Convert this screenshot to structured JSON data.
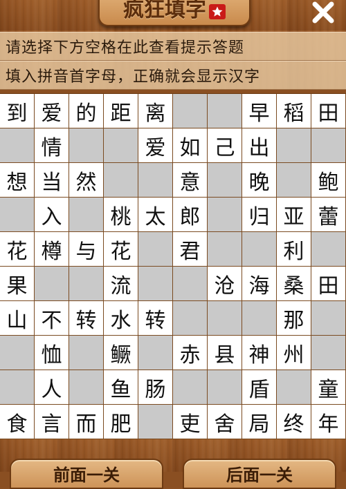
{
  "title": "疯狂填字",
  "hints": {
    "line1": "请选择下方空格在此查看提示答题",
    "line2": "填入拼音首字母，正确就会显示汉字"
  },
  "grid": [
    [
      "到",
      "爱",
      "的",
      "距",
      "离",
      "",
      "",
      "早",
      "稻",
      "田"
    ],
    [
      "",
      "情",
      "",
      "",
      "爱",
      "如",
      "己",
      "出",
      "",
      ""
    ],
    [
      "想",
      "当",
      "然",
      "",
      "",
      "意",
      "",
      "晚",
      "",
      "鲍"
    ],
    [
      "",
      "入",
      "",
      "桃",
      "太",
      "郎",
      "",
      "归",
      "亚",
      "蕾"
    ],
    [
      "花",
      "樽",
      "与",
      "花",
      "",
      "君",
      "",
      "",
      "利",
      ""
    ],
    [
      "果",
      "",
      "",
      "流",
      "",
      "",
      "沧",
      "海",
      "桑",
      "田"
    ],
    [
      "山",
      "不",
      "转",
      "水",
      "转",
      "",
      "",
      "",
      "那",
      ""
    ],
    [
      "",
      "恤",
      "",
      "鳜",
      "",
      "赤",
      "县",
      "神",
      "州",
      ""
    ],
    [
      "",
      "人",
      "",
      "鱼",
      "肠",
      "",
      "",
      "盾",
      "",
      "童"
    ],
    [
      "食",
      "言",
      "而",
      "肥",
      "",
      "吏",
      "舍",
      "局",
      "终",
      "年"
    ]
  ],
  "nav": {
    "prev_label": "前面一关",
    "next_label": "后面一关"
  },
  "icons": {
    "close": "close-icon",
    "title_badge": "star-icon"
  },
  "colors": {
    "wood": "#8a4f22",
    "hint_bg": "#e6c8a0",
    "cell_filled": "#ffffff",
    "cell_empty": "#c9c9c9",
    "grid_line": "#7a4a20"
  }
}
